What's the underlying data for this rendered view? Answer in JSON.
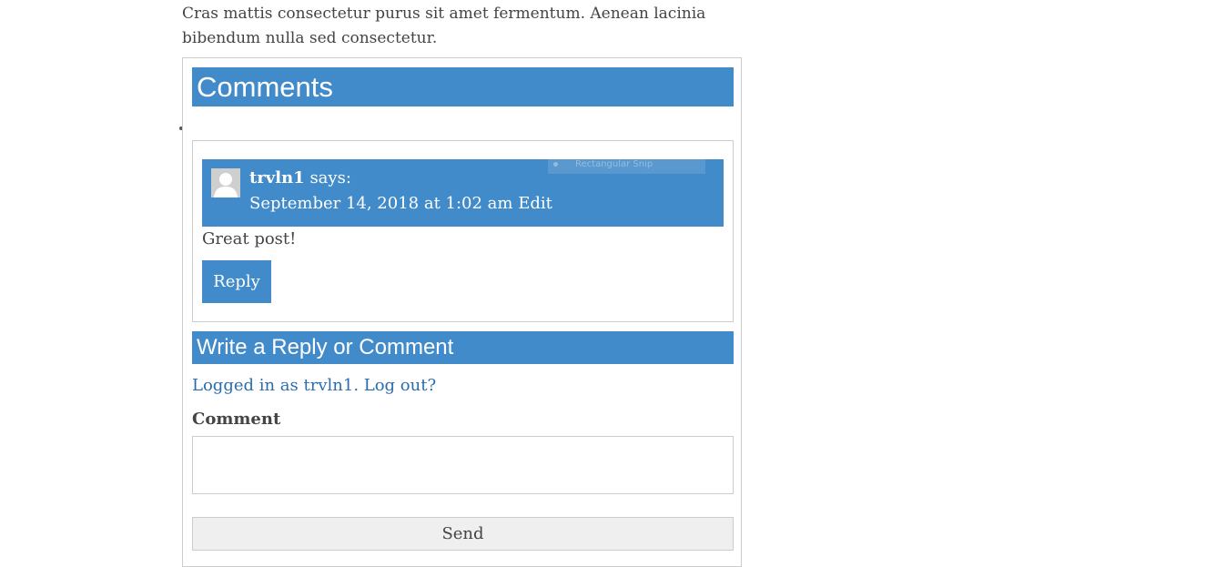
{
  "post": {
    "intro_text": "Cras mattis consectetur purus sit amet fermentum. Aenean lacinia bibendum nulla sed consectetur."
  },
  "comments_section": {
    "heading": "Comments",
    "comment": {
      "author": "trvln1",
      "says": " says:",
      "date": "September 14, 2018 at 1:02 am",
      "edit_link": "Edit",
      "text": "Great post!",
      "reply_label": "Reply"
    },
    "overlay": {
      "label": "Rectangular Snip"
    }
  },
  "reply_form": {
    "heading": "Write a Reply or Comment",
    "logged_in_prefix": "Logged in as ",
    "username": "trvln1",
    "logout_link": "Log out?",
    "comment_label": "Comment",
    "comment_value": "",
    "send_label": "Send"
  },
  "colors": {
    "accent": "#428bca",
    "text": "#444444",
    "link": "#2b6cb0"
  }
}
